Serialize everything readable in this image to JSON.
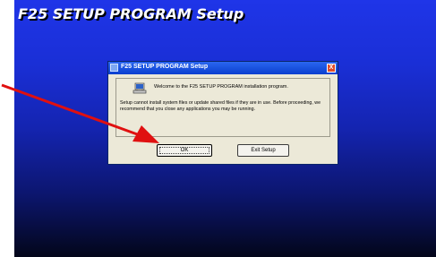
{
  "setup_screen": {
    "title": "F25 SETUP PROGRAM Setup"
  },
  "dialog": {
    "title": "F25 SETUP PROGRAM Setup",
    "close_label": "X",
    "welcome_text": "Welcome to the F25 SETUP PROGRAM installation program.",
    "warning_text": "Setup cannot install system files or update shared files if they are in use. Before proceeding, we recommend that you close any applications you may be running.",
    "ok_label": "OK",
    "exit_label": "Exit Setup"
  },
  "colors": {
    "background_top": "#1f35e8",
    "background_bottom": "#03061a",
    "annotation_arrow": "#e01010"
  },
  "icons": [
    "computer-icon",
    "close-icon"
  ]
}
